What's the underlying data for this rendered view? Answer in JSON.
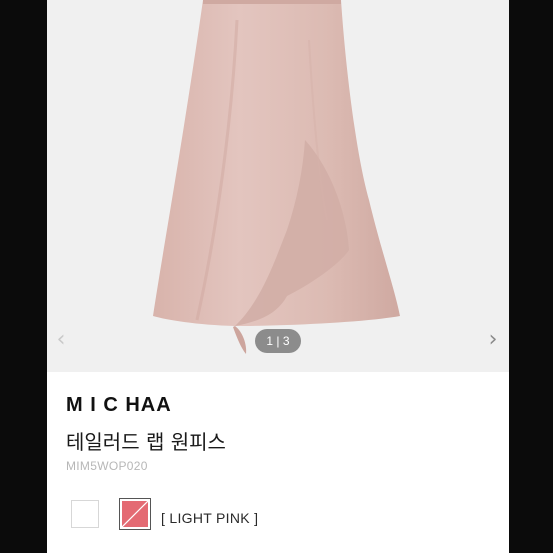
{
  "gallery": {
    "counter": "1 | 3",
    "prev_icon": "chevron-left-icon",
    "next_icon": "chevron-right-icon",
    "product_color": "#dfc0b9"
  },
  "product": {
    "brand": "M I C HAA",
    "name": "테일러드 랩 원피스",
    "code": "MIM5WOP020"
  },
  "colors": {
    "options": [
      {
        "name": "white",
        "hex": "#ffffff",
        "selected": false
      },
      {
        "name": "light-pink",
        "hex": "#e46a73",
        "selected": true
      }
    ],
    "selected_label": "[ LIGHT PINK ]"
  }
}
